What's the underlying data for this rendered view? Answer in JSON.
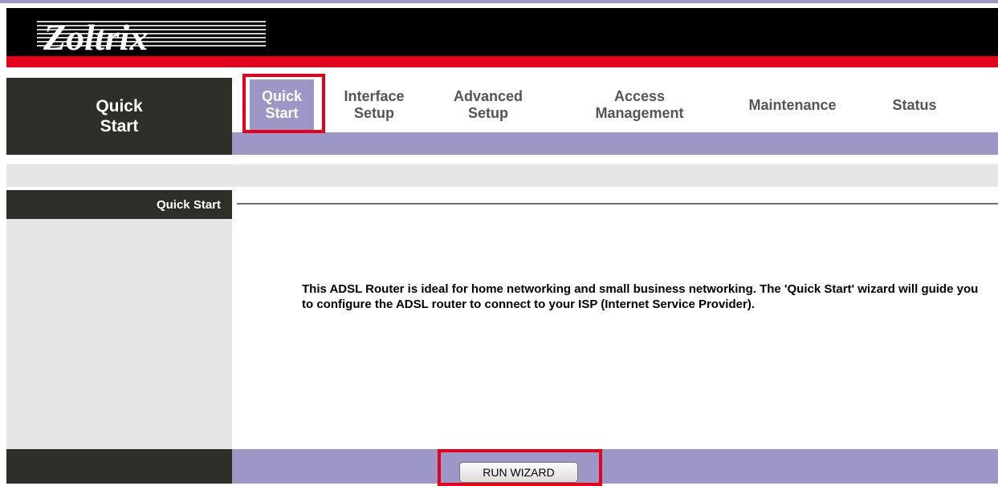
{
  "brand": {
    "logo_text": "Zoltrix"
  },
  "sidebar": {
    "title_line1": "Quick",
    "title_line2": "Start"
  },
  "nav": {
    "tabs": [
      {
        "label": "Quick\nStart",
        "active": true
      },
      {
        "label": "Interface\nSetup"
      },
      {
        "label": "Advanced\nSetup"
      },
      {
        "label": "Access\nManagement"
      },
      {
        "label": "Maintenance"
      },
      {
        "label": "Status"
      }
    ]
  },
  "section": {
    "title": "Quick Start"
  },
  "content": {
    "description": "This ADSL Router is ideal for home networking and small business networking. The 'Quick Start' wizard will guide you to configure the ADSL router to connect to your ISP (Internet Service Provider)."
  },
  "actions": {
    "run_wizard_label": "RUN WIZARD"
  },
  "colors": {
    "accent": "#9c97c6",
    "brand_red": "#e3001b",
    "dark": "#2e2d27",
    "light_gray": "#e6e6e6"
  }
}
